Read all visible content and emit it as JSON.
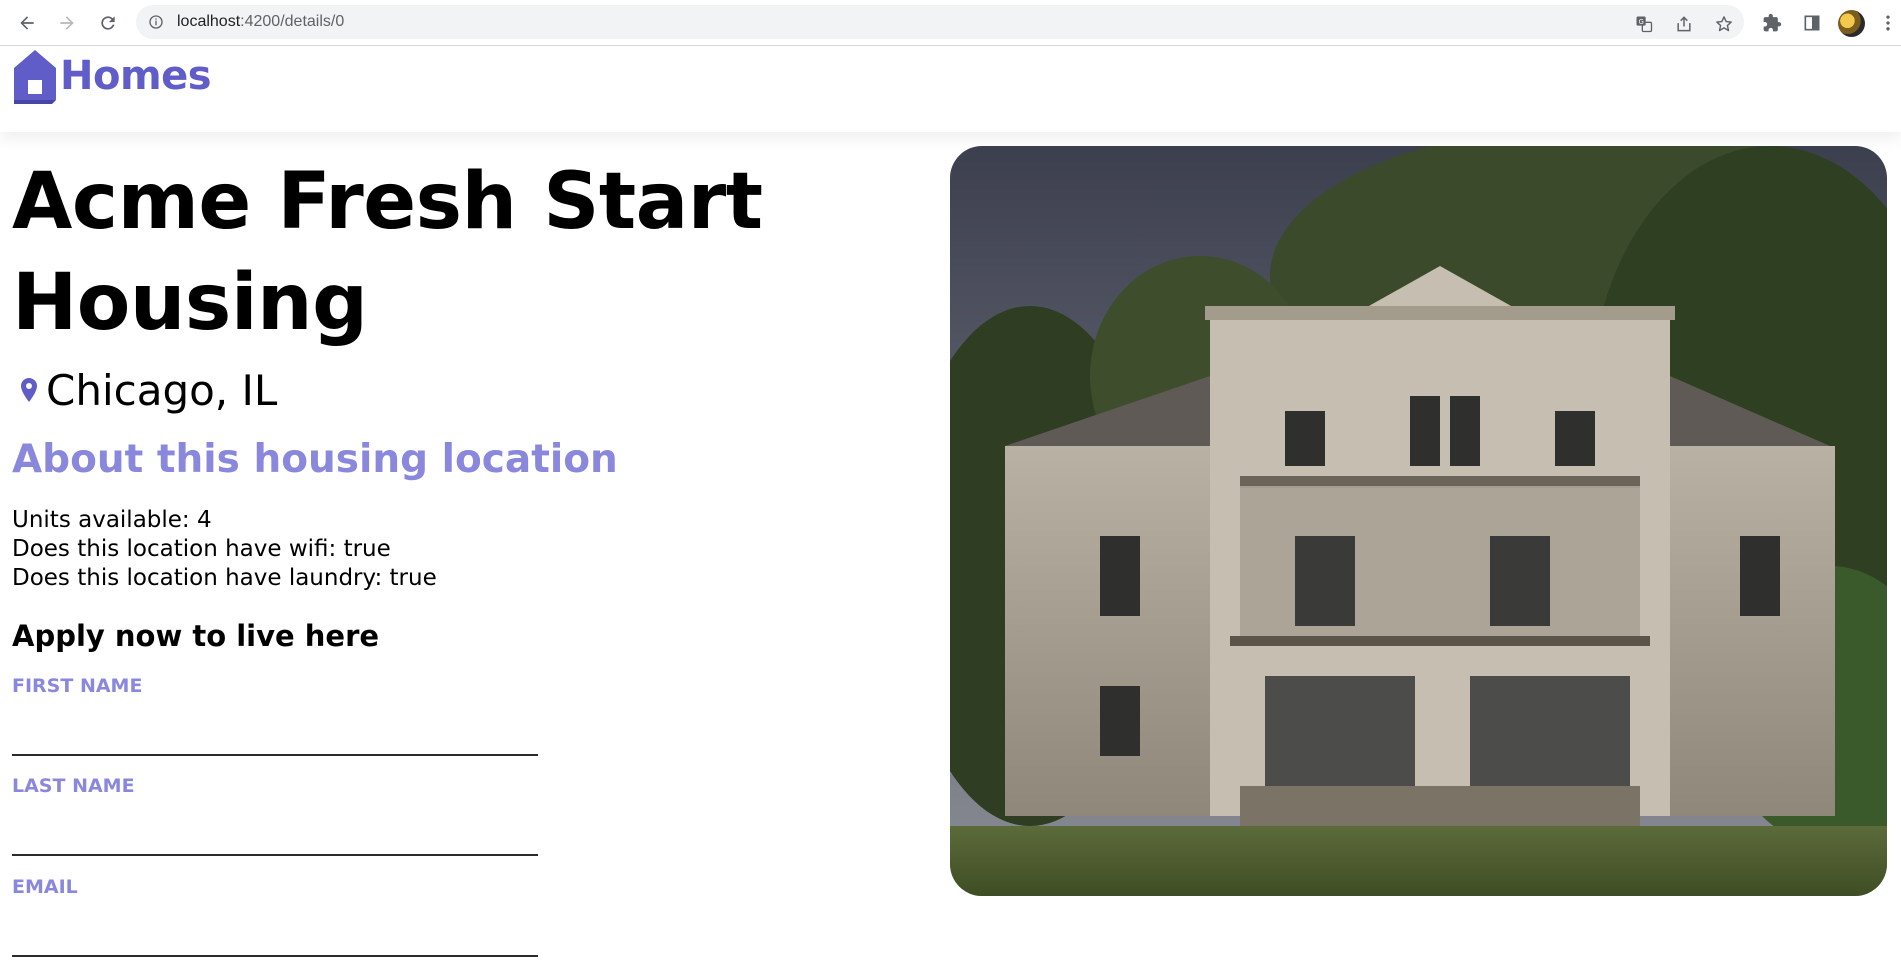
{
  "browser": {
    "url_host": "localhost",
    "url_path": ":4200/details/0"
  },
  "app": {
    "brand_name": "Homes",
    "brand_color": "#605dc8",
    "accent_color": "#8a88dc"
  },
  "listing": {
    "name": "Acme Fresh Start Housing",
    "location": "Chicago, IL",
    "about_heading": "About this housing location",
    "features": [
      "Units available: 4",
      "Does this location have wifi: true",
      "Does this location have laundry: true"
    ],
    "photo": "house-photo"
  },
  "apply_form": {
    "heading": "Apply now to live here",
    "first_name_label": "First Name",
    "last_name_label": "Last Name",
    "email_label": "Email",
    "first_name_value": "",
    "last_name_value": "",
    "email_value": ""
  },
  "icons": {
    "back": "arrow-left-icon",
    "forward": "arrow-right-icon",
    "reload": "reload-icon",
    "site_info": "info-icon",
    "translate": "translate-icon",
    "share": "share-icon",
    "bookmark": "star-icon",
    "extensions": "puzzle-icon",
    "side_panel": "side-panel-icon",
    "menu": "kebab-menu-icon",
    "brand_logo": "house-icon",
    "location": "map-pin-icon"
  }
}
